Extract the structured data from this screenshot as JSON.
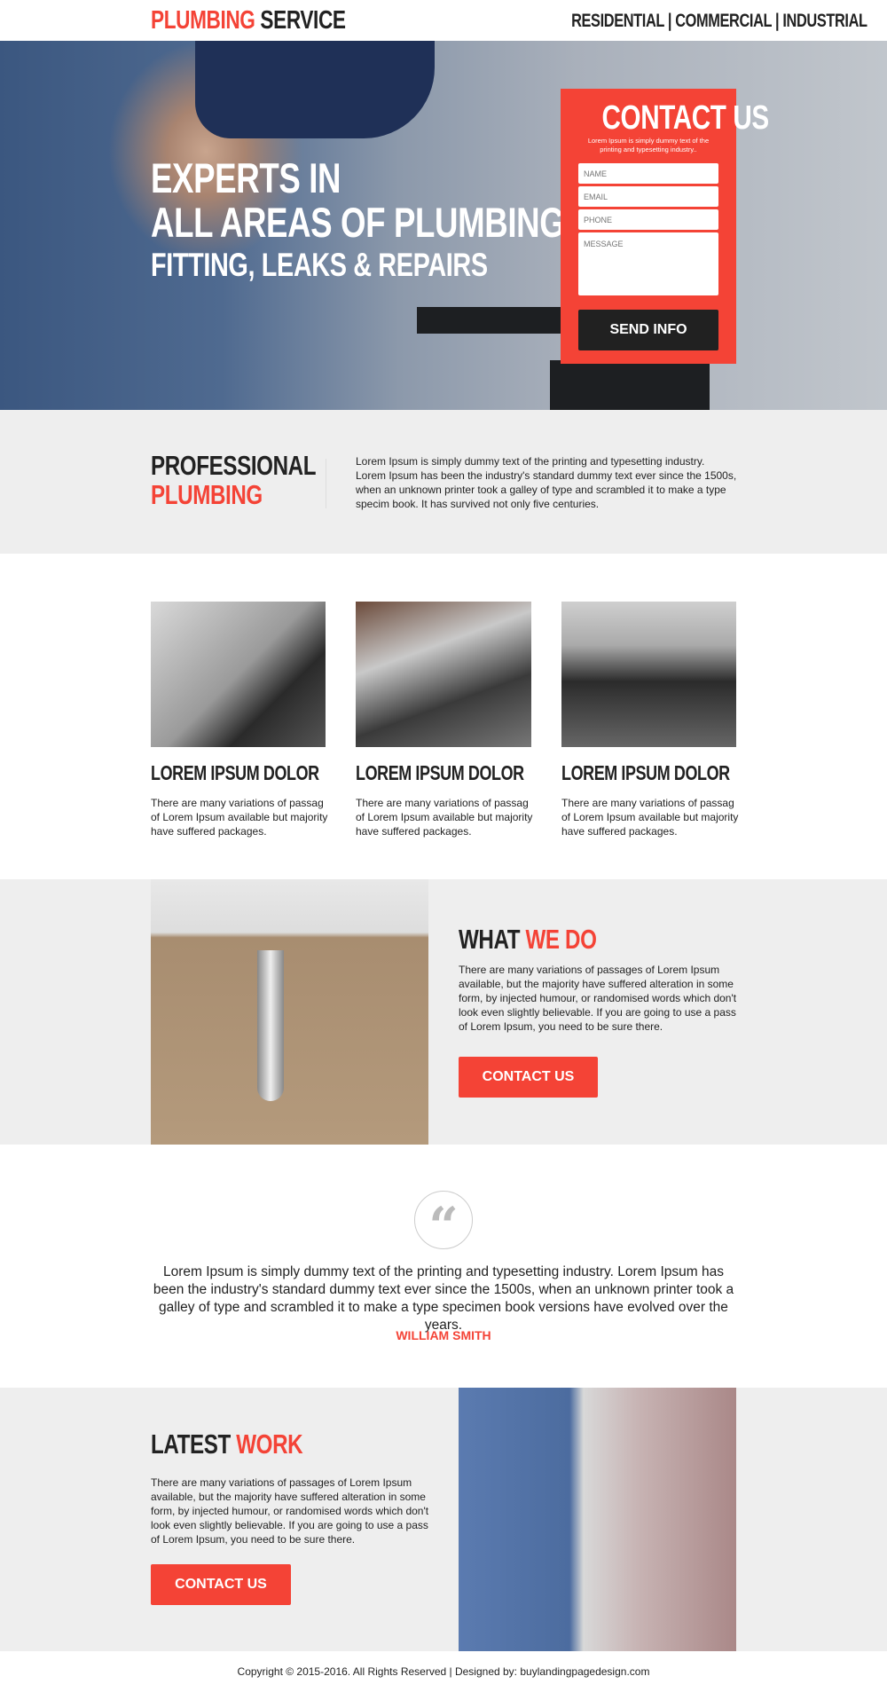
{
  "header": {
    "brand_red": "PLUMBING",
    "brand_dark": "SERVICE",
    "nav": "RESIDENTIAL | COMMERCIAL | INDUSTRIAL"
  },
  "hero": {
    "line1": "EXPERTS IN",
    "line2": "ALL AREAS OF PLUMBING",
    "line3": "FITTING, LEAKS & REPAIRS"
  },
  "form": {
    "title": "CONTACT US",
    "subtitle": "Lorem Ipsum is simply dummy text of the printing and typesetting industry..",
    "name_placeholder": "NAME",
    "email_placeholder": "EMAIL",
    "phone_placeholder": "PHONE",
    "message_placeholder": "MESSAGE",
    "submit": "SEND INFO"
  },
  "professional": {
    "title_dark": "PROFESSIONAL",
    "title_red": "PLUMBING",
    "text": "Lorem Ipsum is simply dummy text of the printing and typesetting industry. Lorem Ipsum has been the industry's standard dummy text ever since the 1500s, when an unknown printer took a galley of type and scrambled it to make a type specim book. It has survived not only five centuries."
  },
  "cards": [
    {
      "title": "LOREM IPSUM DOLOR",
      "text": "There are many variations of passag of Lorem Ipsum available but majority have suffered packages."
    },
    {
      "title": "LOREM IPSUM DOLOR",
      "text": "There are many variations of passag of Lorem Ipsum available but majority have suffered packages."
    },
    {
      "title": "LOREM IPSUM DOLOR",
      "text": "There are many variations of passag of Lorem Ipsum available but majority have suffered packages."
    }
  ],
  "what_we_do": {
    "title_dark": "WHAT",
    "title_red": "WE DO",
    "text": "There are many variations of passages of Lorem Ipsum available, but the majority have suffered alteration in some form, by injected humour, or randomised words which don't look even slightly believable. If you are going to use a pass of Lorem Ipsum, you need to be sure there.",
    "button": "CONTACT US"
  },
  "testimonial": {
    "icon": "quote-icon",
    "text": "Lorem Ipsum is simply dummy text of the printing and typesetting industry. Lorem Ipsum has been the industry's standard dummy text ever since the 1500s, when an unknown printer took a galley of type and scrambled it to make a type specimen book versions have evolved over the years.",
    "author": "WILLIAM SMITH"
  },
  "latest_work": {
    "title_dark": "LATEST",
    "title_red": "WORK",
    "text": "There are many variations of passages of Lorem Ipsum available, but the majority have suffered alteration in some form, by injected humour, or randomised words which don't look even slightly believable. If you are going to use a pass of Lorem Ipsum, you need to be sure there.",
    "button": "CONTACT US"
  },
  "footer": {
    "text": "Copyright © 2015-2016. All Rights Reserved  |  Designed by: buylandingpagedesign.com"
  },
  "colors": {
    "accent": "#f44336",
    "dark": "#212121",
    "section_gray": "#eeeeee"
  }
}
